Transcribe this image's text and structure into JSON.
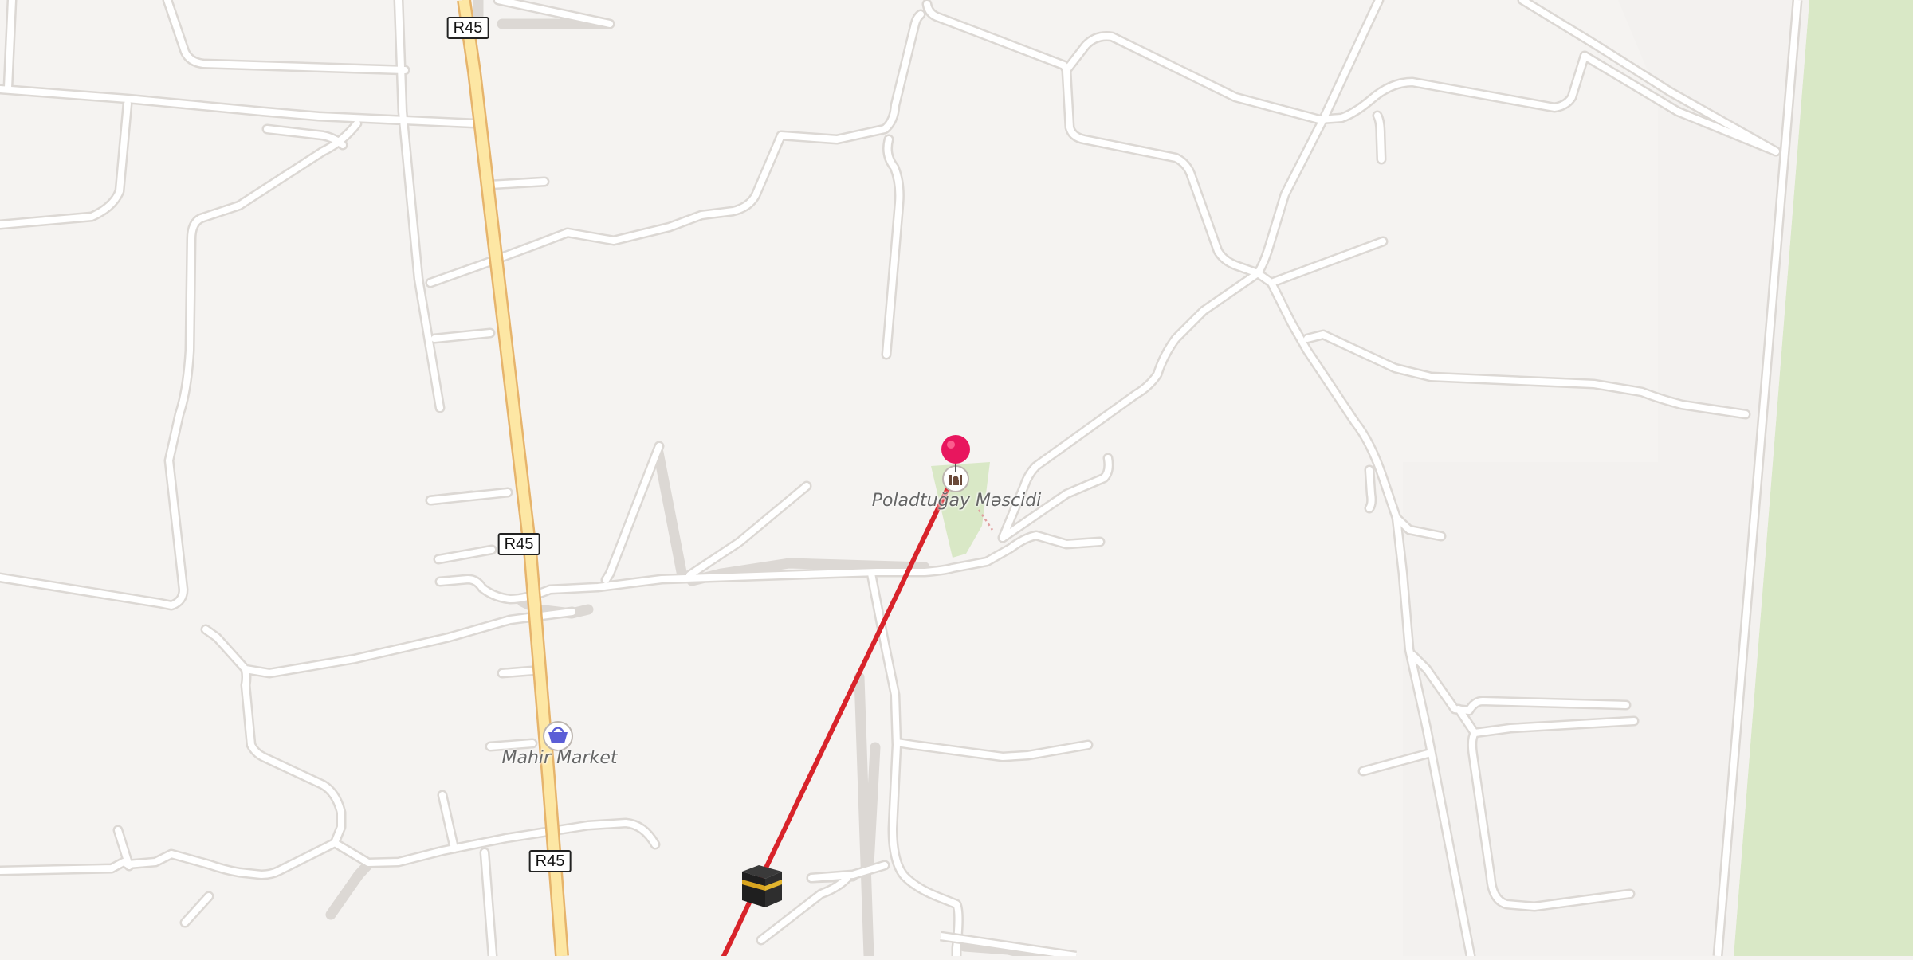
{
  "map": {
    "colors": {
      "background": "#f5f3f1",
      "road": "#ffffff",
      "road_casing": "#dcd8d4",
      "primary_road": "#fde7a4",
      "primary_casing": "#e6b46c",
      "park": "#d9e8c6",
      "route": "#d8232a",
      "pin": "#e8165e"
    },
    "road_shields": [
      {
        "ref": "R45"
      },
      {
        "ref": "R45"
      },
      {
        "ref": "R45"
      }
    ],
    "places": [
      {
        "name": "Poladtuğay Məscidi",
        "icon": "mosque-icon"
      },
      {
        "name": "Mahir Market",
        "icon": "shopping-basket-icon"
      }
    ],
    "route_destination_icon": "kaaba-icon",
    "location_pin_icon": "map-pin-icon"
  }
}
